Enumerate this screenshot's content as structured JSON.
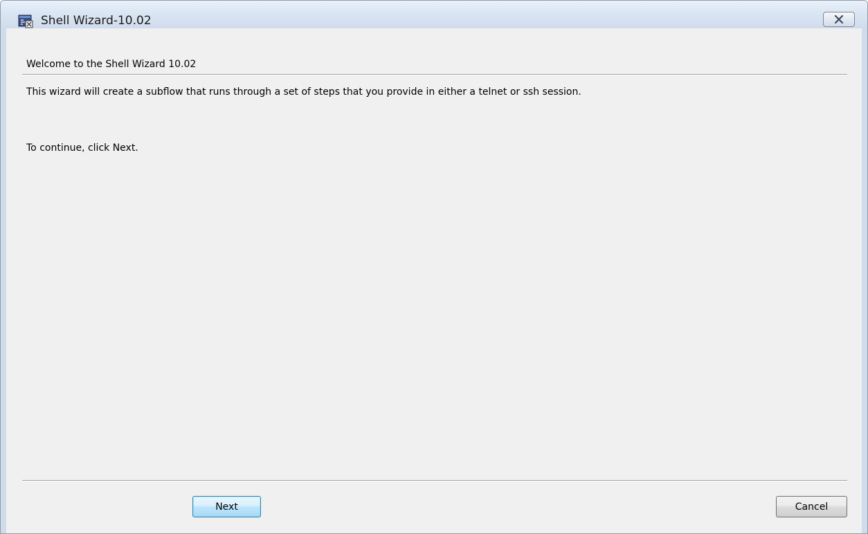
{
  "window": {
    "title": "Shell Wizard-10.02",
    "app_icon": "wizard-app-icon",
    "close_icon": "close-icon"
  },
  "page": {
    "heading": "Welcome to the Shell Wizard 10.02",
    "description": "This wizard will create a subflow that runs through a set of steps that you provide in either a telnet or ssh session.",
    "instruction": "To continue, click Next."
  },
  "buttons": {
    "next_label": "Next",
    "cancel_label": "Cancel"
  },
  "colors": {
    "titlebar": "#dbe6f3",
    "body": "#f0f0f0",
    "default_button_border": "#3c7fb1"
  }
}
